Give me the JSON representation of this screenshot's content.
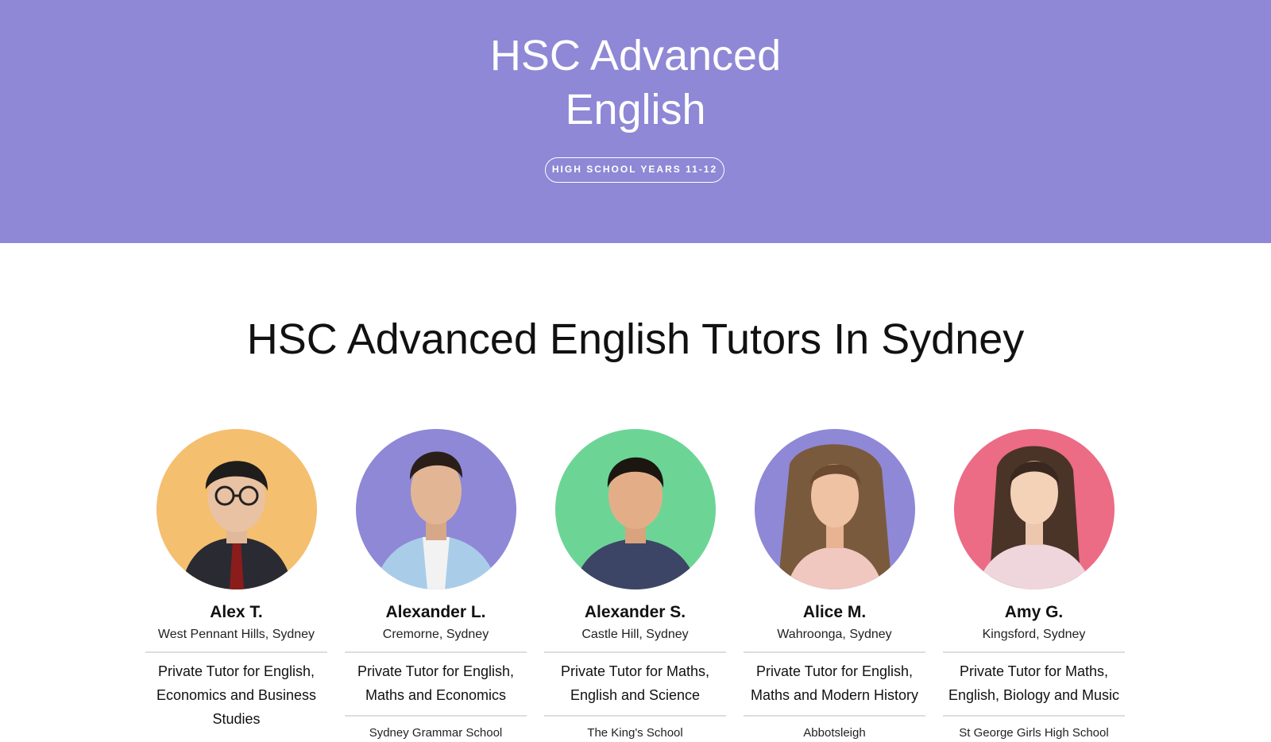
{
  "hero": {
    "title_line1": "HSC Advanced",
    "title_line2": "English",
    "badge": "HIGH SCHOOL YEARS 11-12",
    "background_color": "#8e88d6"
  },
  "section": {
    "title": "HSC Advanced English Tutors In Sydney"
  },
  "tutors": [
    {
      "name": "Alex T.",
      "location": "West Pennant Hills, Sydney",
      "subjects": "Private Tutor for English, Economics and Business Studies",
      "school": "",
      "avatar_bg": "#f4bf6f",
      "avatar_icon": "person-photo"
    },
    {
      "name": "Alexander L.",
      "location": "Cremorne, Sydney",
      "subjects": "Private Tutor for English, Maths and Economics",
      "school": "Sydney Grammar School",
      "avatar_bg": "#8e88d6",
      "avatar_icon": "person-photo"
    },
    {
      "name": "Alexander S.",
      "location": "Castle Hill, Sydney",
      "subjects": "Private Tutor for Maths, English and Science",
      "school": "The King's School",
      "avatar_bg": "#6cd596",
      "avatar_icon": "person-photo"
    },
    {
      "name": "Alice M.",
      "location": "Wahroonga, Sydney",
      "subjects": "Private Tutor for English, Maths and Modern History",
      "school": "Abbotsleigh",
      "avatar_bg": "#8e88d6",
      "avatar_icon": "person-photo"
    },
    {
      "name": "Amy G.",
      "location": "Kingsford, Sydney",
      "subjects": "Private Tutor for Maths, English, Biology and Music",
      "school": "St George Girls High School",
      "avatar_bg": "#ec6b85",
      "avatar_icon": "person-photo"
    }
  ]
}
